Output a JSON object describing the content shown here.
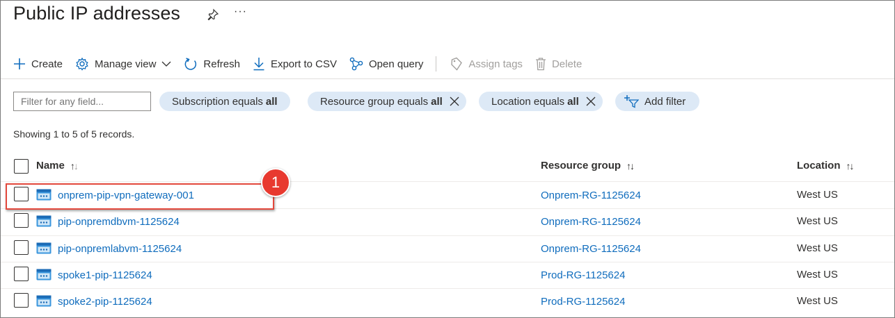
{
  "page": {
    "title": "Public IP addresses"
  },
  "title_icons": {
    "pin": "pin-icon",
    "more": "···"
  },
  "toolbar": {
    "create": "Create",
    "manage_view": "Manage view",
    "refresh": "Refresh",
    "export_csv": "Export to CSV",
    "open_query": "Open query",
    "assign_tags": "Assign tags",
    "delete": "Delete"
  },
  "filters": {
    "placeholder": "Filter for any field...",
    "subscription_label": "Subscription equals",
    "subscription_value": "all",
    "resource_group_label": "Resource group equals",
    "resource_group_value": "all",
    "location_label": "Location equals",
    "location_value": "all",
    "add_filter": "Add filter"
  },
  "records_text": "Showing 1 to 5 of 5 records.",
  "table": {
    "columns": {
      "name": "Name",
      "resource_group": "Resource group",
      "location": "Location"
    },
    "rows": [
      {
        "name": "onprem-pip-vpn-gateway-001",
        "resource_group": "Onprem-RG-1125624",
        "location": "West US"
      },
      {
        "name": "pip-onpremdbvm-1125624",
        "resource_group": "Onprem-RG-1125624",
        "location": "West US"
      },
      {
        "name": "pip-onpremlabvm-1125624",
        "resource_group": "Onprem-RG-1125624",
        "location": "West US"
      },
      {
        "name": "spoke1-pip-1125624",
        "resource_group": "Prod-RG-1125624",
        "location": "West US"
      },
      {
        "name": "spoke2-pip-1125624",
        "resource_group": "Prod-RG-1125624",
        "location": "West US"
      }
    ]
  },
  "callout": {
    "number": "1"
  },
  "colors": {
    "link": "#0f6cbd",
    "pill": "#dde9f6",
    "callout": "#e8392f",
    "icon_accent": "#3a96dd"
  }
}
